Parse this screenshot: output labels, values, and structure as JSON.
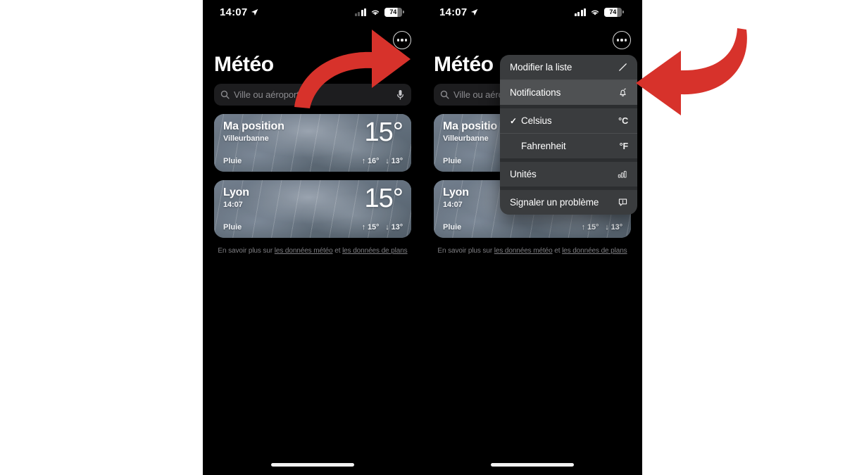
{
  "screen": {
    "background": "#ffffff",
    "accent_red": "#d7322b"
  },
  "phones": [
    {
      "id": "left",
      "status": {
        "time": "14:07",
        "location_icon": "location-arrow-icon",
        "signal_icon": "cellular-bars-icon",
        "wifi_icon": "wifi-icon",
        "battery_level": "74"
      },
      "header": {
        "title": "Météo",
        "more_button_icon": "ellipsis-circle-icon"
      },
      "search": {
        "placeholder": "Ville ou aéroport",
        "search_icon": "search-icon",
        "mic_icon": "microphone-icon"
      },
      "cards": [
        {
          "name": "Ma position",
          "sub": "Villeurbanne",
          "condition": "Pluie",
          "temp": "15°",
          "high": "↑ 16°",
          "low": "↓ 13°"
        },
        {
          "name": "Lyon",
          "sub": "14:07",
          "condition": "Pluie",
          "temp": "15°",
          "high": "↑ 15°",
          "low": "↓ 13°"
        }
      ],
      "footnote": {
        "prefix": "En savoir plus sur ",
        "link1": "les données météo",
        "middle": " et ",
        "link2": "les données de plans"
      },
      "menu_open": false
    },
    {
      "id": "right",
      "status": {
        "time": "14:07",
        "location_icon": "location-arrow-icon",
        "signal_icon": "cellular-bars-icon",
        "wifi_icon": "wifi-icon",
        "battery_level": "74"
      },
      "header": {
        "title": "Météo",
        "more_button_icon": "ellipsis-circle-icon"
      },
      "search": {
        "placeholder": "Ville ou aéro",
        "search_icon": "search-icon",
        "mic_icon": "microphone-icon"
      },
      "cards": [
        {
          "name": "Ma positio",
          "sub": "Villeurbanne",
          "condition": "Pluie",
          "temp": "",
          "high": "",
          "low": ""
        },
        {
          "name": "Lyon",
          "sub": "14:07",
          "condition": "Pluie",
          "temp": "",
          "high": "↑ 15°",
          "low": "↓ 13°"
        }
      ],
      "footnote": {
        "prefix": "En savoir plus sur ",
        "link1": "les données météo",
        "middle": " et ",
        "link2": "les données de plans"
      },
      "menu_open": true
    }
  ],
  "context_menu": {
    "items": [
      {
        "label": "Modifier la liste",
        "icon": "pencil-icon",
        "glyph": "",
        "checked": false,
        "highlighted": false
      },
      {
        "label": "Notifications",
        "icon": "bell-icon",
        "glyph": "",
        "checked": false,
        "highlighted": true
      },
      {
        "label": "Celsius",
        "icon": "",
        "glyph": "°C",
        "checked": true,
        "highlighted": false
      },
      {
        "label": "Fahrenheit",
        "icon": "",
        "glyph": "°F",
        "checked": false,
        "highlighted": false
      },
      {
        "label": "Unités",
        "icon": "bars-icon",
        "glyph": "",
        "checked": false,
        "highlighted": false
      },
      {
        "label": "Signaler un problème",
        "icon": "speech-bubble-exclamation-icon",
        "glyph": "",
        "checked": false,
        "highlighted": false
      }
    ],
    "check_glyph": "✓"
  },
  "annotations": {
    "arrow_left": {
      "name": "red-arrow-pointing-to-more-button",
      "color": "#d7322b"
    },
    "arrow_right": {
      "name": "red-arrow-pointing-to-menu",
      "color": "#d7322b"
    }
  }
}
